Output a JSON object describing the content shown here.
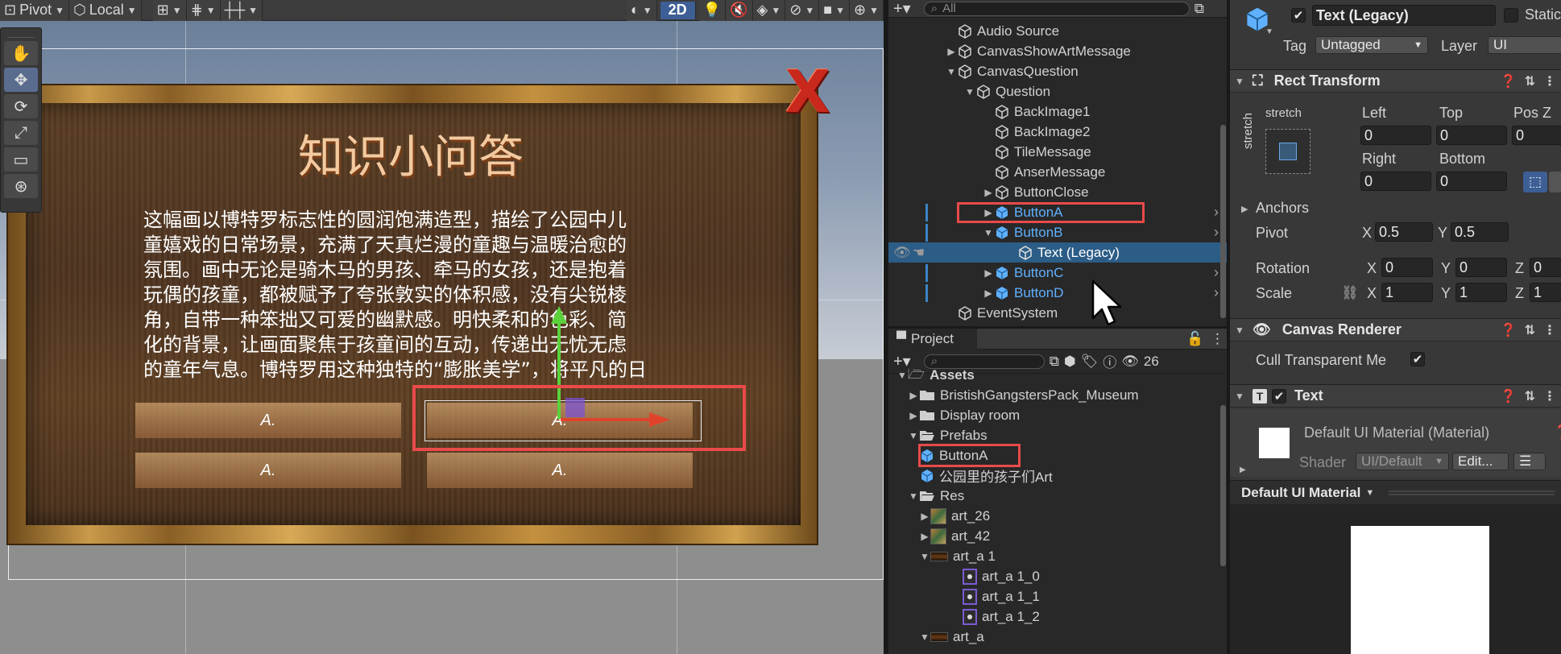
{
  "scene": {
    "toolbar": {
      "pivot": "Pivot",
      "local": "Local",
      "mode_2d": "2D"
    },
    "quiz": {
      "title": "知识小问答",
      "close": "X",
      "lines": [
        "这幅画以博特罗标志性的圆润饱满造型，描绘了公园中儿",
        "童嬉戏的日常场景，充满了天真烂漫的童趣与温暖治愈的",
        "氛围。画中无论是骑木马的男孩、牵马的女孩，还是抱着",
        "玩偶的孩童，都被赋予了夸张敦实的体积感，没有尖锐棱",
        "角，自带一种笨拙又可爱的幽默感。明快柔和的色彩、简",
        "化的背景，让画面聚焦于孩童间的互动，传递出无忧无虑",
        "的童年气息。博特罗用这种独特的“膨胀美学”，将平凡的日"
      ],
      "answers": [
        "A.",
        "A.",
        "A.",
        "A."
      ]
    }
  },
  "hierarchy": {
    "search_placeholder": "All",
    "items": [
      {
        "label": "Audio Source",
        "blue": false
      },
      {
        "label": "CanvasShowArtMessage",
        "blue": false
      },
      {
        "label": "CanvasQuestion",
        "blue": false
      },
      {
        "label": "Question",
        "blue": false
      },
      {
        "label": "BackImage1",
        "blue": false
      },
      {
        "label": "BackImage2",
        "blue": false
      },
      {
        "label": "TileMessage",
        "blue": false
      },
      {
        "label": "AnserMessage",
        "blue": false
      },
      {
        "label": "ButtonClose",
        "blue": false
      },
      {
        "label": "ButtonA",
        "blue": true
      },
      {
        "label": "ButtonB",
        "blue": true
      },
      {
        "label": "Text (Legacy)",
        "blue": false
      },
      {
        "label": "ButtonC",
        "blue": true
      },
      {
        "label": "ButtonD",
        "blue": true
      },
      {
        "label": "EventSystem",
        "blue": false
      }
    ]
  },
  "project": {
    "tab": "Project",
    "count": "26",
    "items": [
      {
        "label": "Assets"
      },
      {
        "label": "BristishGangstersPack_Museum"
      },
      {
        "label": "Display room"
      },
      {
        "label": "Prefabs"
      },
      {
        "label": "ButtonA"
      },
      {
        "label": "公园里的孩子们Art"
      },
      {
        "label": "Res"
      },
      {
        "label": "art_26"
      },
      {
        "label": "art_42"
      },
      {
        "label": "art_a 1"
      },
      {
        "label": "art_a 1_0"
      },
      {
        "label": "art_a 1_1"
      },
      {
        "label": "art_a 1_2"
      },
      {
        "label": "art_a"
      }
    ]
  },
  "inspector": {
    "object_name": "Text (Legacy)",
    "static_label": "Static",
    "tag_label": "Tag",
    "tag_value": "Untagged",
    "layer_label": "Layer",
    "layer_value": "UI",
    "rect_transform": {
      "title": "Rect Transform",
      "stretch_h": "stretch",
      "stretch_v": "stretch",
      "left_label": "Left",
      "left": "0",
      "top_label": "Top",
      "top": "0",
      "posz_label": "Pos Z",
      "posz": "0",
      "right_label": "Right",
      "right": "0",
      "bottom_label": "Bottom",
      "bottom": "0",
      "anchors_label": "Anchors",
      "pivot_label": "Pivot",
      "pivot_x": "0.5",
      "pivot_y": "0.5",
      "rotation_label": "Rotation",
      "rot_x": "0",
      "rot_y": "0",
      "rot_z": "0",
      "scale_label": "Scale",
      "scale_x": "1",
      "scale_y": "1",
      "scale_z": "1",
      "x": "X",
      "y": "Y",
      "z": "Z"
    },
    "canvas_renderer": {
      "title": "Canvas Renderer",
      "cull_label": "Cull Transparent Me"
    },
    "text": {
      "title": "Text",
      "material_name": "Default UI Material (Material)",
      "shader_label": "Shader",
      "shader_value": "UI/Default",
      "edit_label": "Edit..."
    },
    "preview_title": "Default UI Material"
  },
  "colors": {
    "selection": "#2c5d87",
    "highlight_box": "#e94a4a",
    "prefab_blue": "#5fb1ff"
  }
}
